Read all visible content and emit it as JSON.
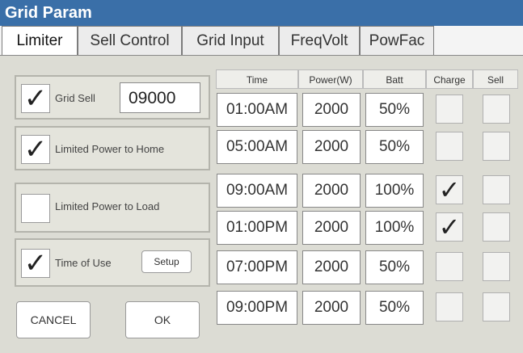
{
  "title": "Grid Param",
  "tabs": [
    {
      "label": "Limiter"
    },
    {
      "label": "Sell Control"
    },
    {
      "label": "Grid Input"
    },
    {
      "label": "FreqVolt"
    },
    {
      "label": "PowFac"
    }
  ],
  "options": {
    "grid_sell": {
      "label": "Grid Sell",
      "checked": true,
      "value": "09000"
    },
    "limited_home": {
      "label": "Limited Power to Home",
      "checked": true
    },
    "limited_load": {
      "label": "Limited Power to Load",
      "checked": false
    },
    "time_of_use": {
      "label": "Time of Use",
      "checked": true,
      "setup_label": "Setup"
    }
  },
  "buttons": {
    "cancel": "CANCEL",
    "ok": "OK"
  },
  "table": {
    "headers": [
      "Time",
      "Power(W)",
      "Batt",
      "Charge",
      "Sell"
    ],
    "rows": [
      {
        "time": "01:00AM",
        "power": "2000",
        "batt": "50%",
        "charge": false,
        "sell": false
      },
      {
        "time": "05:00AM",
        "power": "2000",
        "batt": "50%",
        "charge": false,
        "sell": false
      },
      {
        "time": "09:00AM",
        "power": "2000",
        "batt": "100%",
        "charge": true,
        "sell": false
      },
      {
        "time": "01:00PM",
        "power": "2000",
        "batt": "100%",
        "charge": true,
        "sell": false
      },
      {
        "time": "07:00PM",
        "power": "2000",
        "batt": "50%",
        "charge": false,
        "sell": false
      },
      {
        "time": "09:00PM",
        "power": "2000",
        "batt": "50%",
        "charge": false,
        "sell": false
      }
    ]
  },
  "icons": {
    "checkmark": "✓"
  }
}
